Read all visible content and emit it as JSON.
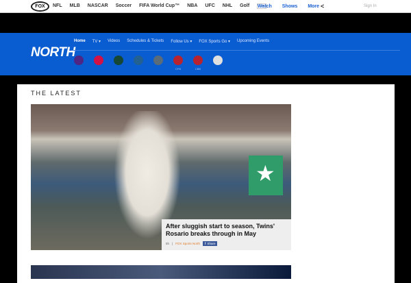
{
  "topbar": {
    "logo": "FOX",
    "nav": [
      "NFL",
      "MLB",
      "NASCAR",
      "Soccer",
      "FIFA World Cup™",
      "NBA",
      "UFC",
      "NHL",
      "Golf"
    ],
    "more_dots": "···",
    "links": [
      "Watch",
      "Shows",
      "More"
    ],
    "share_icon": "share-icon",
    "sign_in": "Sign In"
  },
  "region": {
    "name": "NORTH",
    "nav": [
      "Home",
      "TV ▾",
      "Videos",
      "Schedules & Tickets",
      "Follow Us ▾",
      "FOX Sports Go ▾",
      "Upcoming Events"
    ],
    "teams": [
      {
        "name": "vikings",
        "color": "#4f2683",
        "label": ""
      },
      {
        "name": "twins",
        "color": "#d31145",
        "label": ""
      },
      {
        "name": "wild",
        "color": "#154734",
        "label": ""
      },
      {
        "name": "timberwolves",
        "color": "#236192",
        "label": ""
      },
      {
        "name": "lynx",
        "color": "#5a6b7a",
        "label": ""
      },
      {
        "name": "gophers-cfb",
        "color": "#b8232f",
        "label": "CFB"
      },
      {
        "name": "gophers-cbb",
        "color": "#b8232f",
        "label": "CBB"
      },
      {
        "name": "united",
        "color": "#e0e0e0",
        "label": ""
      }
    ]
  },
  "main": {
    "section_title": "THE LATEST",
    "story": {
      "headline": "After sluggish start to season, Twins' Rosario breaks through in May",
      "age": "5h",
      "source": "FOX Sports North",
      "share": "Share"
    }
  }
}
